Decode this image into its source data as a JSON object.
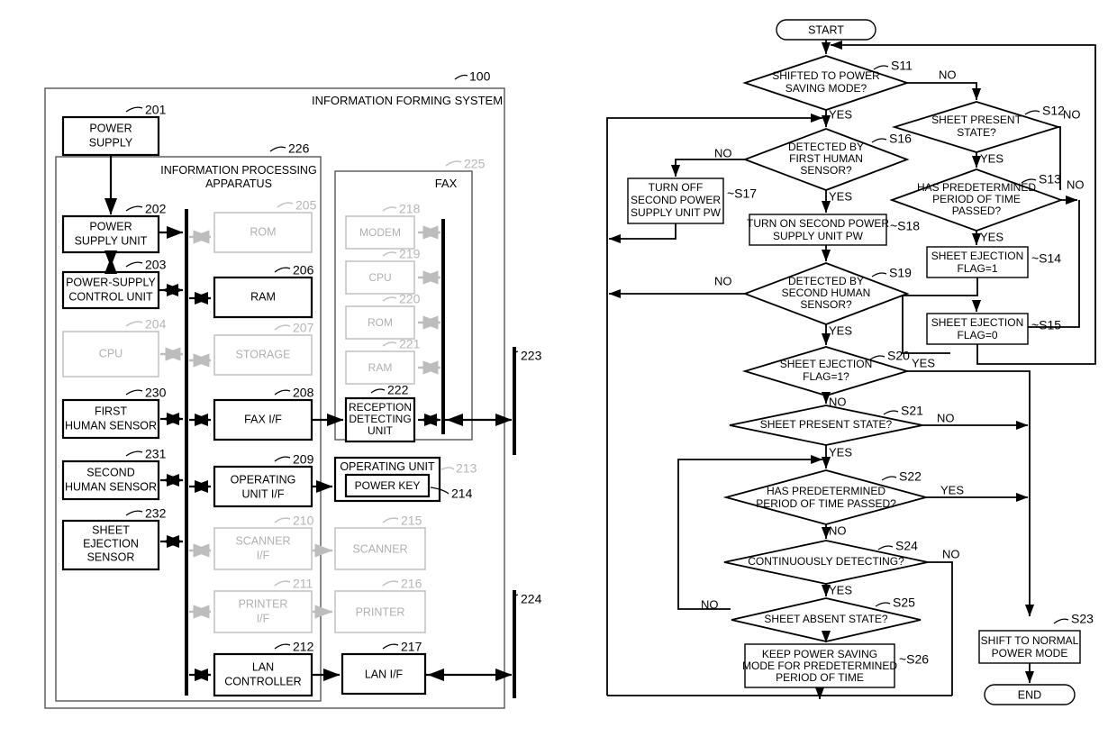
{
  "figure": {
    "left_diagram": {
      "system_label": "INFORMATION FORMING SYSTEM",
      "system_ref": "100",
      "apparatus_label": "INFORMATION PROCESSING APPARATUS",
      "apparatus_ref": "226",
      "fax_label": "FAX",
      "fax_ref": "225",
      "bus_ref_top": "223",
      "bus_ref_bottom": "224",
      "blocks": [
        {
          "id": "power-supply",
          "label": "POWER SUPPLY",
          "ref": "201",
          "ghost": false
        },
        {
          "id": "power-supply-unit",
          "label": "POWER SUPPLY UNIT",
          "ref": "202",
          "ghost": false
        },
        {
          "id": "power-supply-control-unit",
          "label": "POWER-SUPPLY CONTROL UNIT",
          "ref": "203",
          "ghost": false
        },
        {
          "id": "cpu",
          "label": "CPU",
          "ref": "204",
          "ghost": true
        },
        {
          "id": "first-human-sensor",
          "label": "FIRST HUMAN SENSOR",
          "ref": "230",
          "ghost": false
        },
        {
          "id": "second-human-sensor",
          "label": "SECOND HUMAN SENSOR",
          "ref": "231",
          "ghost": false
        },
        {
          "id": "sheet-ejection-sensor",
          "label": "SHEET EJECTION SENSOR",
          "ref": "232",
          "ghost": false
        },
        {
          "id": "rom",
          "label": "ROM",
          "ref": "205",
          "ghost": true
        },
        {
          "id": "ram",
          "label": "RAM",
          "ref": "206",
          "ghost": false
        },
        {
          "id": "storage",
          "label": "STORAGE",
          "ref": "207",
          "ghost": true
        },
        {
          "id": "fax-if",
          "label": "FAX I/F",
          "ref": "208",
          "ghost": false
        },
        {
          "id": "operating-unit-if",
          "label": "OPERATING UNIT I/F",
          "ref": "209",
          "ghost": false
        },
        {
          "id": "scanner-if",
          "label": "SCANNER I/F",
          "ref": "210",
          "ghost": true
        },
        {
          "id": "printer-if",
          "label": "PRINTER I/F",
          "ref": "211",
          "ghost": true
        },
        {
          "id": "lan-controller",
          "label": "LAN CONTROLLER",
          "ref": "212",
          "ghost": false
        },
        {
          "id": "modem",
          "label": "MODEM",
          "ref": "218",
          "ghost": true
        },
        {
          "id": "fax-cpu",
          "label": "CPU",
          "ref": "219",
          "ghost": true
        },
        {
          "id": "fax-rom",
          "label": "ROM",
          "ref": "220",
          "ghost": true
        },
        {
          "id": "fax-ram",
          "label": "RAM",
          "ref": "221",
          "ghost": true
        },
        {
          "id": "reception-detecting-unit",
          "label": "RECEPTION DETECTING UNIT",
          "ref": "222",
          "ghost": false
        },
        {
          "id": "operating-unit",
          "label": "OPERATING UNIT",
          "ref": "213",
          "ghost": true
        },
        {
          "id": "power-key",
          "label": "POWER KEY",
          "ref": "214",
          "ghost": false
        },
        {
          "id": "scanner",
          "label": "SCANNER",
          "ref": "215",
          "ghost": true
        },
        {
          "id": "printer",
          "label": "PRINTER",
          "ref": "216",
          "ghost": true
        },
        {
          "id": "lan-if",
          "label": "LAN I/F",
          "ref": "217",
          "ghost": false
        }
      ]
    },
    "flowchart": {
      "start_label": "START",
      "end_label": "END",
      "yes_label": "YES",
      "no_label": "NO",
      "nodes": [
        {
          "id": "s11",
          "type": "decision",
          "ref": "S11",
          "label": "SHIFTED TO POWER SAVING MODE?"
        },
        {
          "id": "s12",
          "type": "decision",
          "ref": "S12",
          "label": "SHEET PRESENT STATE?"
        },
        {
          "id": "s13",
          "type": "decision",
          "ref": "S13",
          "label": "HAS PREDETERMINED PERIOD OF TIME PASSED?"
        },
        {
          "id": "s14",
          "type": "process",
          "ref": "S14",
          "label": "SHEET EJECTION FLAG=1"
        },
        {
          "id": "s15",
          "type": "process",
          "ref": "S15",
          "label": "SHEET EJECTION FLAG=0"
        },
        {
          "id": "s16",
          "type": "decision",
          "ref": "S16",
          "label": "DETECTED BY FIRST HUMAN SENSOR?"
        },
        {
          "id": "s17",
          "type": "process",
          "ref": "S17",
          "label": "TURN OFF SECOND POWER SUPPLY UNIT PW"
        },
        {
          "id": "s18",
          "type": "process",
          "ref": "S18",
          "label": "TURN ON SECOND POWER SUPPLY UNIT PW"
        },
        {
          "id": "s19",
          "type": "decision",
          "ref": "S19",
          "label": "DETECTED BY SECOND HUMAN SENSOR?"
        },
        {
          "id": "s20",
          "type": "decision",
          "ref": "S20",
          "label": "SHEET EJECTION FLAG=1?"
        },
        {
          "id": "s21",
          "type": "decision",
          "ref": "S21",
          "label": "SHEET PRESENT STATE?"
        },
        {
          "id": "s22",
          "type": "decision",
          "ref": "S22",
          "label": "HAS PREDETERMINED PERIOD OF TIME PASSED?"
        },
        {
          "id": "s23",
          "type": "process",
          "ref": "S23",
          "label": "SHIFT TO NORMAL POWER MODE"
        },
        {
          "id": "s24",
          "type": "decision",
          "ref": "S24",
          "label": "CONTINUOUSLY DETECTING?"
        },
        {
          "id": "s25",
          "type": "decision",
          "ref": "S25",
          "label": "SHEET ABSENT STATE?"
        },
        {
          "id": "s26",
          "type": "process",
          "ref": "S26",
          "label": "KEEP POWER SAVING MODE FOR PREDETERMINED PERIOD OF TIME"
        }
      ]
    }
  },
  "text": {
    "s11_l1": "SHIFTED TO POWER",
    "s11_l2": "SAVING MODE?",
    "s12_l1": "SHEET PRESENT",
    "s12_l2": "STATE?",
    "s13_l1": "HAS PREDETERMINED",
    "s13_l2": "PERIOD OF TIME",
    "s13_l3": "PASSED?",
    "s14_l1": "SHEET EJECTION",
    "s14_l2": "FLAG=1",
    "s15_l1": "SHEET EJECTION",
    "s15_l2": "FLAG=0",
    "s16_l1": "DETECTED BY",
    "s16_l2": "FIRST HUMAN",
    "s16_l3": "SENSOR?",
    "s17_l1": "TURN OFF",
    "s17_l2": "SECOND POWER",
    "s17_l3": "SUPPLY UNIT PW",
    "s18_l1": "TURN ON SECOND POWER",
    "s18_l2": "SUPPLY UNIT PW",
    "s19_l1": "DETECTED BY",
    "s19_l2": "SECOND HUMAN",
    "s19_l3": "SENSOR?",
    "s20_l1": "SHEET EJECTION",
    "s20_l2": "FLAG=1?",
    "s21_l1": "SHEET PRESENT STATE?",
    "s22_l1": "HAS PREDETERMINED",
    "s22_l2": "PERIOD OF TIME PASSED?",
    "s23_l1": "SHIFT TO NORMAL",
    "s23_l2": "POWER MODE",
    "s24_l1": "CONTINUOUSLY DETECTING?",
    "s25_l1": "SHEET ABSENT STATE?",
    "s26_l1": "KEEP POWER SAVING",
    "s26_l2": "MODE FOR PREDETERMINED",
    "s26_l3": "PERIOD OF TIME",
    "b_power_l1": "POWER",
    "b_power_l2": "SUPPLY",
    "b_psu_l1": "POWER",
    "b_psu_l2": "SUPPLY UNIT",
    "b_psc_l1": "POWER-SUPPLY",
    "b_psc_l2": "CONTROL UNIT",
    "b_cpu": "CPU",
    "b_fhs_l1": "FIRST",
    "b_fhs_l2": "HUMAN SENSOR",
    "b_shs_l1": "SECOND",
    "b_shs_l2": "HUMAN SENSOR",
    "b_ses_l1": "SHEET",
    "b_ses_l2": "EJECTION",
    "b_ses_l3": "SENSOR",
    "b_rom": "ROM",
    "b_ram": "RAM",
    "b_storage": "STORAGE",
    "b_faxif": "FAX I/F",
    "b_opif_l1": "OPERATING",
    "b_opif_l2": "UNIT I/F",
    "b_scif_l1": "SCANNER",
    "b_scif_l2": "I/F",
    "b_prif_l1": "PRINTER",
    "b_prif_l2": "I/F",
    "b_lanc_l1": "LAN",
    "b_lanc_l2": "CONTROLLER",
    "b_modem": "MODEM",
    "b_fcpu": "CPU",
    "b_from": "ROM",
    "b_fram": "RAM",
    "b_rdu_l1": "RECEPTION",
    "b_rdu_l2": "DETECTING",
    "b_rdu_l3": "UNIT",
    "b_opu": "OPERATING UNIT",
    "b_pk": "POWER KEY",
    "b_scan": "SCANNER",
    "b_print": "PRINTER",
    "b_lanif": "LAN I/F",
    "hdr_sys": "INFORMATION FORMING SYSTEM",
    "hdr_app_l1": "INFORMATION PROCESSING",
    "hdr_app_l2": "APPARATUS",
    "hdr_fax": "FAX",
    "r100": "100",
    "r201": "201",
    "r202": "202",
    "r203": "203",
    "r204": "204",
    "r205": "205",
    "r206": "206",
    "r207": "207",
    "r208": "208",
    "r209": "209",
    "r210": "210",
    "r211": "211",
    "r212": "212",
    "r213": "213",
    "r214": "214",
    "r215": "215",
    "r216": "216",
    "r217": "217",
    "r218": "218",
    "r219": "219",
    "r220": "220",
    "r221": "221",
    "r222": "222",
    "r223": "223",
    "r224": "224",
    "r225": "225",
    "r226": "226",
    "r230": "230",
    "r231": "231",
    "r232": "232",
    "rS11": "S11",
    "rS12": "S12",
    "rS13": "S13",
    "rS14": "~S14",
    "rS15": "~S15",
    "rS16": "S16",
    "rS17": "~S17",
    "rS18": "~S18",
    "rS19": "S19",
    "rS20": "S20",
    "rS21": "S21",
    "rS22": "S22",
    "rS23": "S23",
    "rS24": "S24",
    "rS25": "S25",
    "rS26": "~S26",
    "start": "START",
    "end": "END",
    "yes": "YES",
    "no": "NO"
  }
}
